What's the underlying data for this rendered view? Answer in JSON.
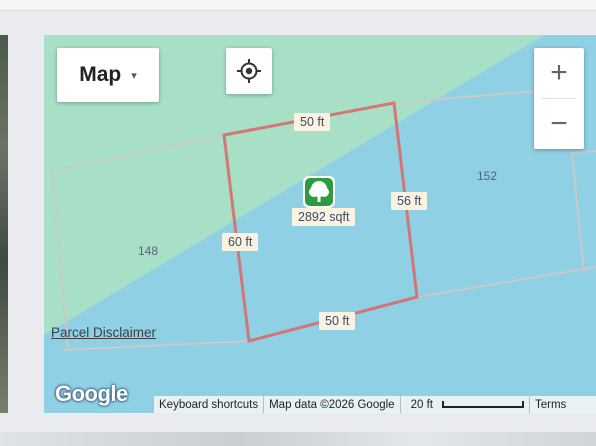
{
  "map": {
    "type_control": {
      "label": "Map",
      "caret": "▾"
    },
    "zoom": {
      "in": "+",
      "out": "−"
    },
    "parcel_numbers": [
      "148",
      "152"
    ],
    "dimensions": {
      "top": "50 ft",
      "right": "56 ft",
      "left": "60 ft",
      "bottom": "50 ft"
    },
    "area": "2892 sqft",
    "disclaimer": "Parcel Disclaimer",
    "logo": "Google",
    "attribution": {
      "shortcuts": "Keyboard shortcuts",
      "map_data": "Map data ©2026 Google",
      "scale": "20 ft",
      "terms": "Terms"
    },
    "colors": {
      "water": "#8ecfe3",
      "land": "#a7e0c7",
      "parcel": "#d96a6a",
      "marker": "#2e9c3e"
    }
  }
}
